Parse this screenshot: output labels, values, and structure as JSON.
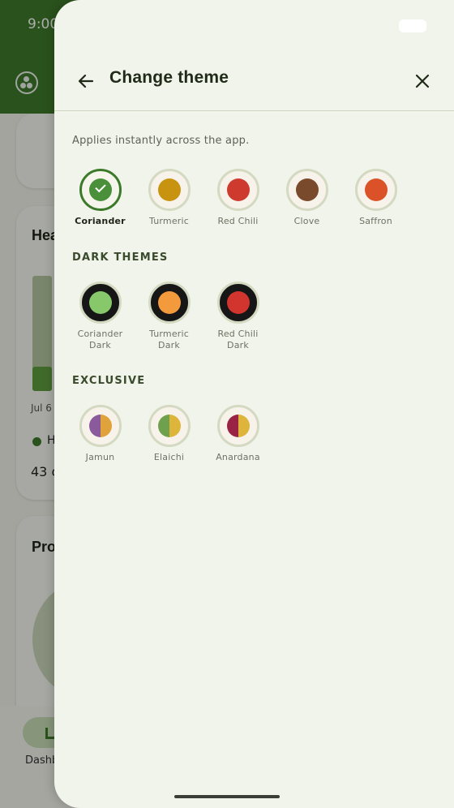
{
  "status_bar": {
    "time": "9:00"
  },
  "background": {
    "card2_title": "Hea",
    "axis_label": "Jul 6",
    "legend_label": "H",
    "count_text": "43 c",
    "card3_title": "Pro",
    "nav_label": "Dashb"
  },
  "sheet": {
    "title": "Change theme",
    "subtitle": "Applies instantly across the app.",
    "light_themes": [
      {
        "label": "Coriander",
        "color": "#4a8f3a",
        "selected": true
      },
      {
        "label": "Turmeric",
        "color": "#c8930f",
        "selected": false
      },
      {
        "label": "Red Chili",
        "color": "#cf3a2e",
        "selected": false
      },
      {
        "label": "Clove",
        "color": "#7a4a2c",
        "selected": false
      },
      {
        "label": "Saffron",
        "color": "#dc5228",
        "selected": false
      }
    ],
    "dark_section_title": "DARK THEMES",
    "dark_themes": [
      {
        "label_line1": "Coriander",
        "label_line2": "Dark",
        "color": "#86c86a"
      },
      {
        "label_line1": "Turmeric",
        "label_line2": "Dark",
        "color": "#f39a3c"
      },
      {
        "label_line1": "Red Chili",
        "label_line2": "Dark",
        "color": "#d1352e"
      }
    ],
    "exclusive_section_title": "EXCLUSIVE",
    "exclusive_themes": [
      {
        "label": "Jamun",
        "left_color": "#8a5a9c",
        "right_color": "#e0a23a"
      },
      {
        "label": "Elaichi",
        "left_color": "#6fa04d",
        "right_color": "#dcb53a"
      },
      {
        "label": "Anardana",
        "left_color": "#9a2244",
        "right_color": "#dcb53a"
      }
    ]
  },
  "colors": {
    "brand_green": "#3e7a2a",
    "sheet_background": "#f1f4ea"
  }
}
